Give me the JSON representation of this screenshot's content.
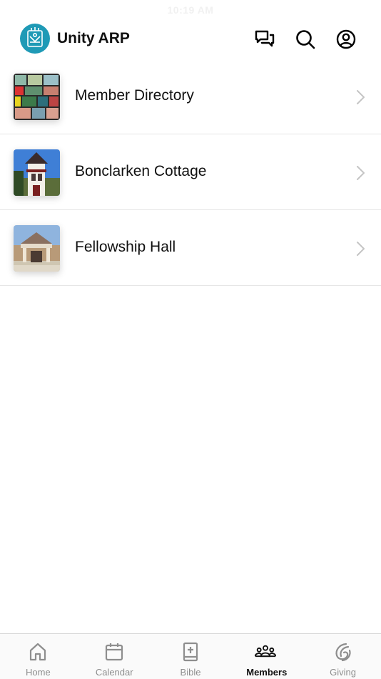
{
  "status_bar": {
    "time": "10:19 AM"
  },
  "header": {
    "title": "Unity ARP",
    "icons": [
      "chat-icon",
      "search-icon",
      "profile-icon"
    ]
  },
  "list": {
    "items": [
      {
        "label": "Member Directory",
        "thumbnail": "stained-glass"
      },
      {
        "label": "Bonclarken Cottage",
        "thumbnail": "bell-tower"
      },
      {
        "label": "Fellowship Hall",
        "thumbnail": "building-entrance"
      }
    ]
  },
  "tabbar": {
    "tabs": [
      {
        "label": "Home",
        "icon": "home-icon"
      },
      {
        "label": "Calendar",
        "icon": "calendar-icon"
      },
      {
        "label": "Bible",
        "icon": "bible-icon"
      },
      {
        "label": "Members",
        "icon": "members-icon"
      },
      {
        "label": "Giving",
        "icon": "giving-icon"
      }
    ],
    "active": "Members"
  },
  "colors": {
    "brand": "#1f9ab6",
    "active_tab": "#111111",
    "inactive_tab": "#8e8e8e",
    "divider": "#e6e6e6"
  }
}
